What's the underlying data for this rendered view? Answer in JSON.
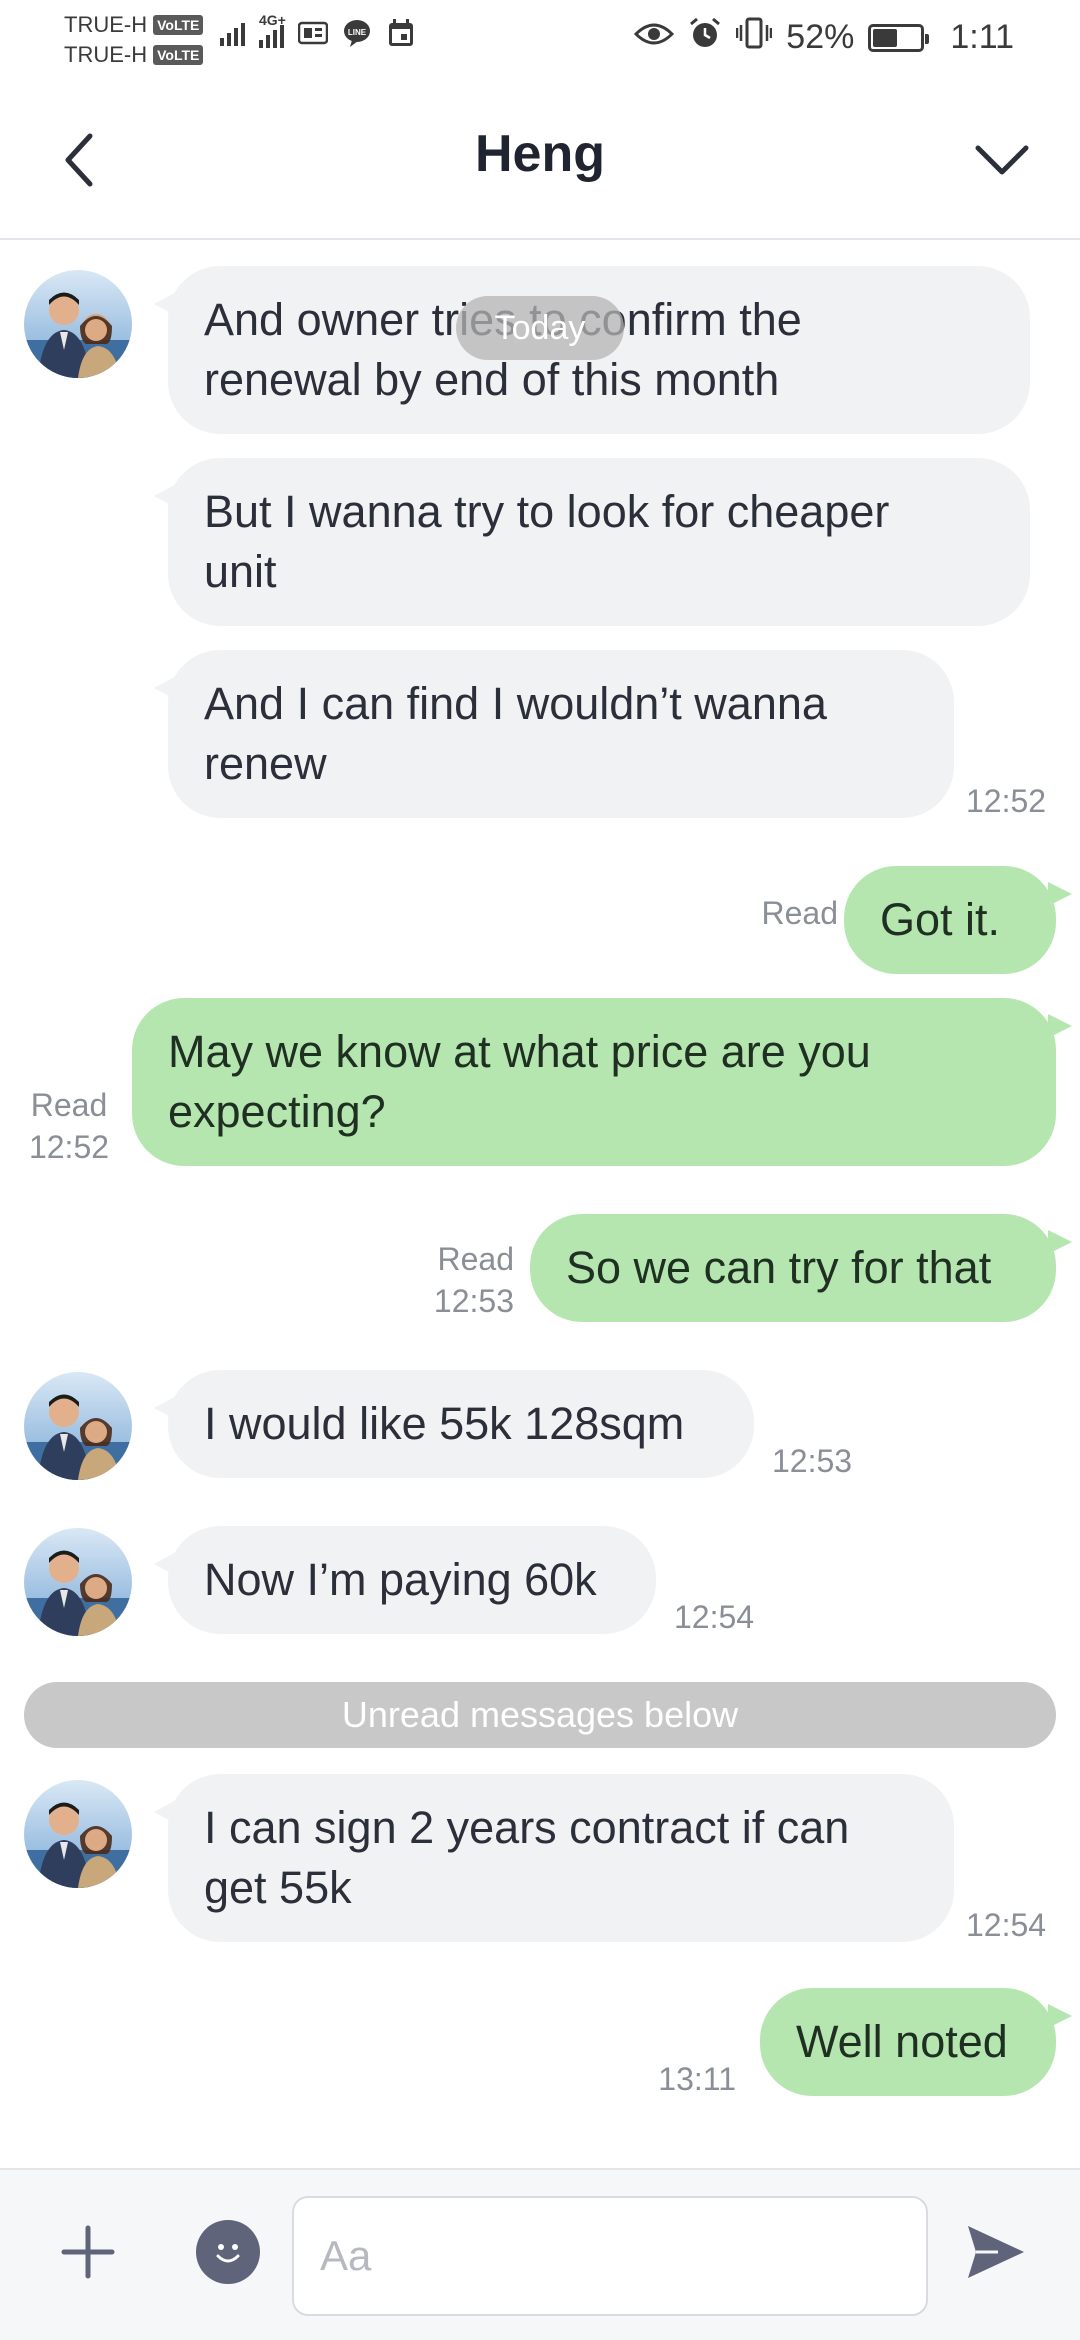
{
  "status_bar": {
    "carrier1": "TRUE-H",
    "carrier2": "TRUE-H",
    "volte": "VoLTE",
    "network": "4G+",
    "battery_percent": "52%",
    "battery_level": 0.52,
    "time": "1:11",
    "icons": [
      "signal-icon",
      "signal-4g-icon",
      "sim-icon",
      "line-app-icon",
      "calendar-icon",
      "eye-icon",
      "alarm-icon",
      "vibrate-icon",
      "battery-icon"
    ]
  },
  "header": {
    "title": "Heng",
    "back_icon": "chevron-left-icon",
    "menu_icon": "chevron-down-icon"
  },
  "chat": {
    "date_pill": "Today",
    "unread_separator": "Unread messages below",
    "messages": [
      {
        "side": "in",
        "text_lines": [
          "And owner tries to confirm the",
          "renewal by end of this month"
        ],
        "time": ""
      },
      {
        "side": "in",
        "text_lines": [
          "But I wanna try to look for cheaper",
          "unit"
        ],
        "time": ""
      },
      {
        "side": "in",
        "text_lines": [
          "And I can find I wouldn’t wanna",
          "renew"
        ],
        "time": "12:52"
      },
      {
        "side": "out",
        "text_lines": [
          "Got it."
        ],
        "read": "Read",
        "time": ""
      },
      {
        "side": "out",
        "text_lines": [
          "May we know at what price are you",
          "expecting?"
        ],
        "read": "Read",
        "time": "12:52"
      },
      {
        "side": "out",
        "text_lines": [
          "So we can try for that"
        ],
        "read": "Read",
        "time": "12:53"
      },
      {
        "side": "in",
        "text_lines": [
          "I would like 55k 128sqm"
        ],
        "time": "12:53"
      },
      {
        "side": "in",
        "text_lines": [
          "Now I’m paying 60k"
        ],
        "time": "12:54"
      },
      {
        "side": "in",
        "text_lines": [
          "I can sign 2 years contract if can",
          "get 55k"
        ],
        "time": "12:54"
      },
      {
        "side": "out",
        "text_lines": [
          "Well noted"
        ],
        "read": "",
        "time": "13:11"
      }
    ]
  },
  "input_bar": {
    "placeholder": "Aa",
    "plus_icon": "plus-icon",
    "emoji_icon": "emoji-icon",
    "send_icon": "send-icon"
  },
  "colors": {
    "incoming_bubble": "#f1f2f4",
    "outgoing_bubble": "#b6e6b0",
    "meta_text": "#8a8e96"
  }
}
